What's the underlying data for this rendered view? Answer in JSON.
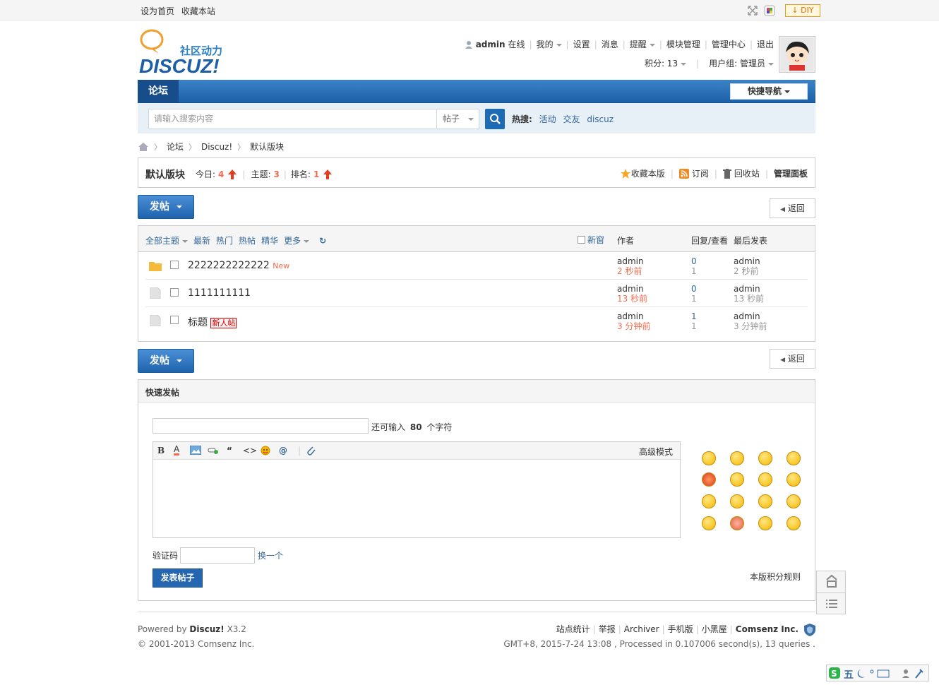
{
  "topbar": {
    "set_home": "设为首页",
    "bookmark": "收藏本站",
    "diy": "DIY"
  },
  "logo": {
    "sub": "社区动力",
    "main": "DISCUZ!"
  },
  "user": {
    "name": "admin",
    "online": "在线",
    "mine": "我的",
    "settings": "设置",
    "messages": "消息",
    "remind": "提醒",
    "portal_manage": "模块管理",
    "admin_center": "管理中心",
    "logout": "退出",
    "credits": "积分: 13",
    "group": "用户组: 管理员"
  },
  "nav": {
    "forum_tab": "论坛",
    "quick_nav": "快捷导航"
  },
  "search": {
    "placeholder": "请输入搜索内容",
    "type": "帖子",
    "hot_label": "热搜:",
    "hot": [
      "活动",
      "交友",
      "discuz"
    ]
  },
  "breadcrumb": {
    "forum": "论坛",
    "cat": "Discuz!",
    "board": "默认版块"
  },
  "forum": {
    "name": "默认版块",
    "today_label": "今日:",
    "today": "4",
    "threads_label": "主题:",
    "threads": "3",
    "rank_label": "排名:",
    "rank": "1",
    "fav": "收藏本版",
    "rss": "订阅",
    "recycle": "回收站",
    "manage": "管理面板"
  },
  "buttons": {
    "post": "发帖",
    "back": "返回"
  },
  "list": {
    "filters": [
      "全部主题",
      "最新",
      "热门",
      "热帖",
      "精华",
      "更多"
    ],
    "new_window": "新窗",
    "col_author": "作者",
    "col_replies": "回复/查看",
    "col_last": "最后发表",
    "threads": [
      {
        "title": "2222222222222",
        "tag": "New",
        "author": "admin",
        "time": "2 秒前",
        "replies": "0",
        "views": "1",
        "last_user": "admin",
        "last_time": "2 秒前"
      },
      {
        "title": "1111111111",
        "tag": "",
        "author": "admin",
        "time": "13 秒前",
        "replies": "0",
        "views": "1",
        "last_user": "admin",
        "last_time": "13 秒前"
      },
      {
        "title": "标题",
        "tag": "新人帖",
        "author": "admin",
        "time": "3 分钟前",
        "replies": "1",
        "views": "1",
        "last_user": "admin",
        "last_time": "3 分钟前"
      }
    ]
  },
  "quickpost": {
    "title": "快速发帖",
    "remain_prefix": "还可输入",
    "remain_num": "80",
    "remain_suffix": "个字符",
    "advanced": "高级模式",
    "seccode_label": "验证码",
    "seccode_change": "换一个",
    "submit": "发表帖子",
    "rules": "本版积分规则"
  },
  "footer": {
    "powered": "Powered by",
    "discuz": "Discuz!",
    "version": "X3.2",
    "copyright": "© 2001-2013 Comsenz Inc.",
    "links": [
      "站点统计",
      "举报",
      "Archiver",
      "手机版",
      "小黑屋"
    ],
    "company": "Comsenz Inc.",
    "stats": "GMT+8, 2015-7-24 13:08 , Processed in 0.107006 second(s), 13 queries ."
  },
  "ime": {
    "mode": "五"
  }
}
